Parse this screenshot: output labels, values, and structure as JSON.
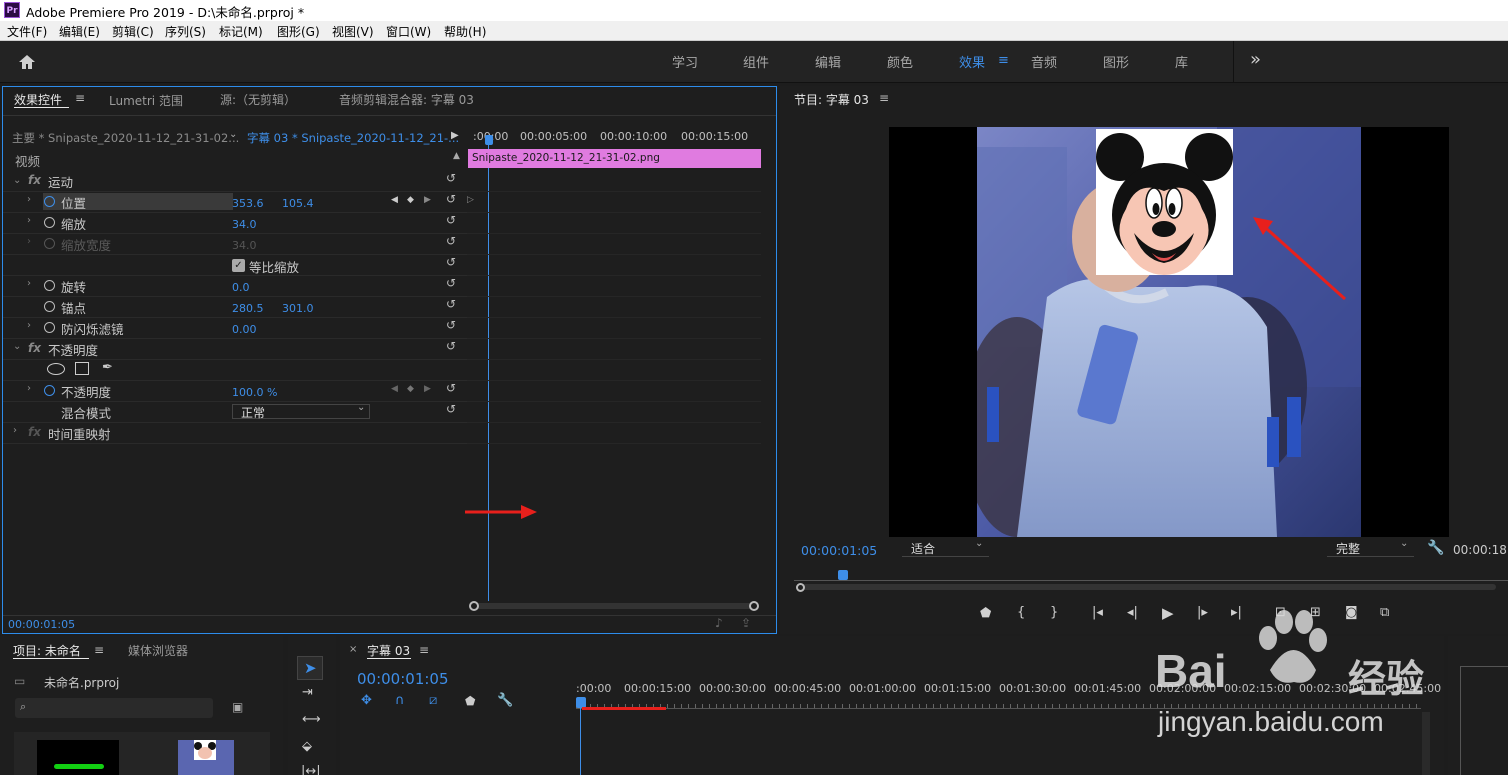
{
  "window": {
    "title": "Adobe Premiere Pro 2019 - D:\\未命名.prproj *",
    "app_icon": "Pr"
  },
  "menu": [
    "文件(F)",
    "编辑(E)",
    "剪辑(C)",
    "序列(S)",
    "标记(M)",
    "图形(G)",
    "视图(V)",
    "窗口(W)",
    "帮助(H)"
  ],
  "workspaces": {
    "tabs": [
      "学习",
      "组件",
      "编辑",
      "颜色",
      "效果",
      "音频",
      "图形",
      "库"
    ],
    "active": "效果",
    "overflow": "»"
  },
  "effect_controls": {
    "tabs": [
      "效果控件",
      "Lumetri 范围",
      "源:（无剪辑）",
      "音频剪辑混合器: 字幕 03"
    ],
    "master_clip": "主要 * Snipaste_2020-11-12_21-31-02...",
    "sequence_clip": "字幕 03 * Snipaste_2020-11-12_21-...",
    "ruler": [
      ":00:00",
      "00:00:05:00",
      "00:00:10:00",
      "00:00:15:00"
    ],
    "clip_name": "Snipaste_2020-11-12_21-31-02.png",
    "video_label": "视频",
    "motion": "运动",
    "position": {
      "label": "位置",
      "x": "353.6",
      "y": "105.4"
    },
    "scale": {
      "label": "缩放",
      "value": "34.0"
    },
    "scale_width": {
      "label": "缩放宽度",
      "value": "34.0"
    },
    "uniform_scale": "等比缩放",
    "rotation": {
      "label": "旋转",
      "value": "0.0"
    },
    "anchor": {
      "label": "锚点",
      "x": "280.5",
      "y": "301.0"
    },
    "antiflicker": {
      "label": "防闪烁滤镜",
      "value": "0.00"
    },
    "opacity_group": "不透明度",
    "opacity": {
      "label": "不透明度",
      "value": "100.0 %"
    },
    "blend": {
      "label": "混合模式",
      "value": "正常"
    },
    "time_remap": "时间重映射",
    "timecode": "00:00:01:05",
    "fx_label": "fx"
  },
  "program": {
    "title": "节目: 字幕 03",
    "timecode": "00:00:01:05",
    "fit": "适合",
    "quality": "完整",
    "duration": "00:00:18"
  },
  "project": {
    "tabs": [
      "项目: 未命名",
      "媒体浏览器"
    ],
    "file": "未命名.prproj"
  },
  "timeline": {
    "title": "字幕 03",
    "timecode": "00:00:01:05",
    "ruler": [
      ":00:00",
      "00:00:15:00",
      "00:00:30:00",
      "00:00:45:00",
      "00:01:00:00",
      "00:01:15:00",
      "00:01:30:00",
      "00:01:45:00",
      "00:02:00:00",
      "00:02:15:00",
      "00:02:30:00",
      "00:02:45:00"
    ]
  },
  "watermark": {
    "brand": "Bai",
    "cn": "经验",
    "url": "jingyan.baidu.com"
  },
  "colors": {
    "accent": "#3e8ee8",
    "clip": "#e07be0",
    "annotation": "#e8201c"
  }
}
